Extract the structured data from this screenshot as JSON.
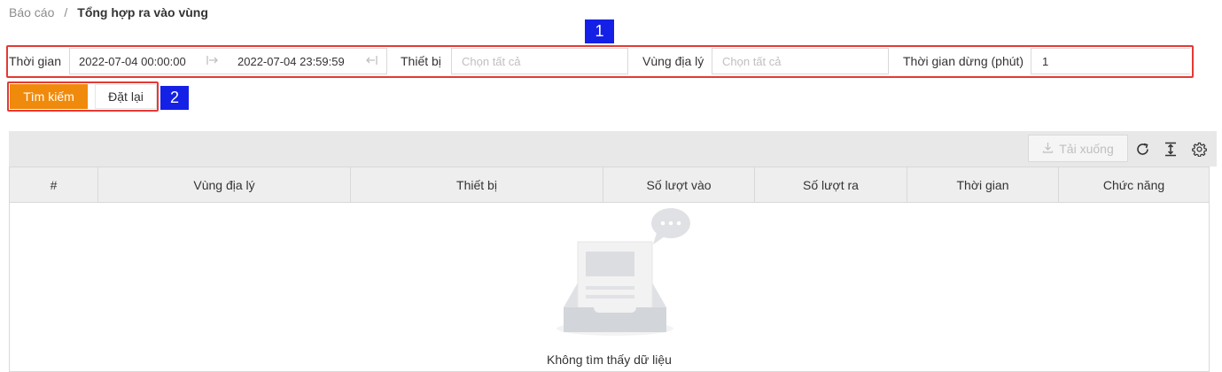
{
  "breadcrumb": {
    "parent": "Báo cáo",
    "separator": "/",
    "current": "Tổng hợp ra vào vùng"
  },
  "filters": {
    "time_label": "Thời gian",
    "start": "2022-07-04 00:00:00",
    "end": "2022-07-04 23:59:59",
    "device_label": "Thiết bị",
    "device_placeholder": "Chọn tất cả",
    "region_label": "Vùng địa lý",
    "region_placeholder": "Chọn tất cả",
    "stop_label": "Thời gian dừng (phút)",
    "stop_value": "1"
  },
  "markers": {
    "one": "1",
    "two": "2"
  },
  "buttons": {
    "search": "Tìm kiếm",
    "reset": "Đặt lại",
    "download": "Tải xuống"
  },
  "table": {
    "columns": [
      "#",
      "Vùng địa lý",
      "Thiết bị",
      "Số lượt vào",
      "Số lượt ra",
      "Thời gian",
      "Chức năng"
    ],
    "empty_text": "Không tìm thấy dữ liệu"
  },
  "colors": {
    "accent": "#f08a0c",
    "highlight": "#e53935",
    "marker": "#1520e6"
  },
  "icons": [
    "arrow-right-to-icon",
    "arrow-left-to-icon",
    "download-icon",
    "refresh-icon",
    "column-height-icon",
    "settings-icon",
    "empty-inbox-icon"
  ]
}
